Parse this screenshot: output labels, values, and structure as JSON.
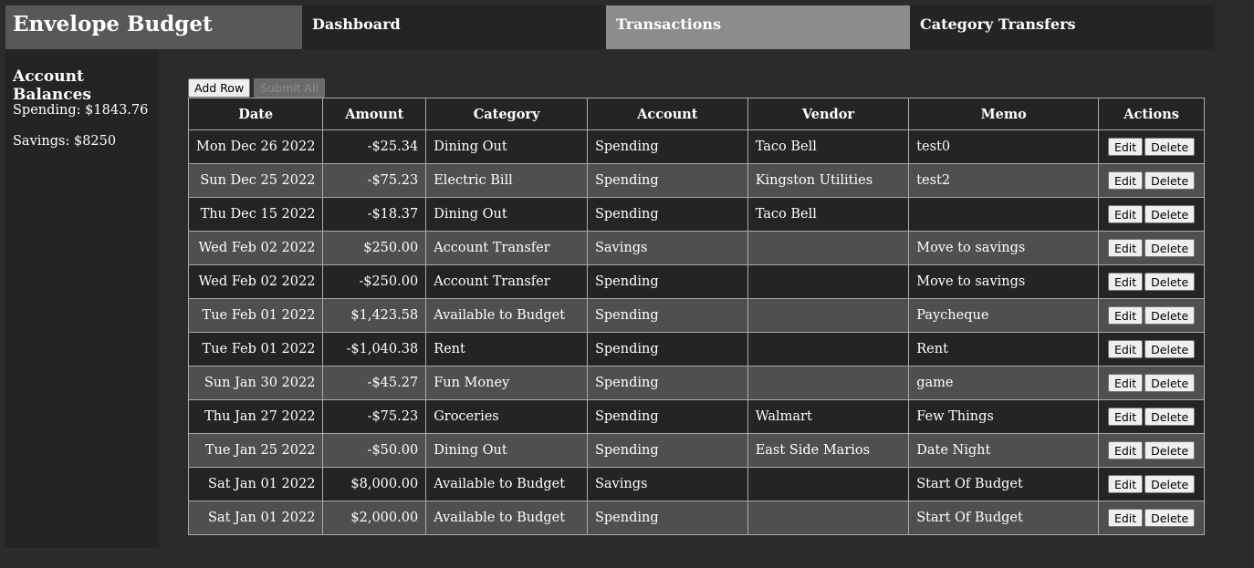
{
  "app": {
    "title": "Envelope Budget"
  },
  "nav": {
    "tabs": [
      {
        "label": "Dashboard",
        "active": false
      },
      {
        "label": "Transactions",
        "active": true
      },
      {
        "label": "Category Transfers",
        "active": false
      }
    ]
  },
  "sidebar": {
    "heading": "Account Balances",
    "balances": [
      "Spending: $1843.76",
      "Savings: $8250"
    ]
  },
  "toolbar": {
    "add_row": "Add Row",
    "submit_all": "Submit All"
  },
  "table": {
    "headers": [
      "Date",
      "Amount",
      "Category",
      "Account",
      "Vendor",
      "Memo",
      "Actions"
    ],
    "edit_label": "Edit",
    "delete_label": "Delete",
    "rows": [
      {
        "date": "Mon Dec 26 2022",
        "amount": "-$25.34",
        "category": "Dining Out",
        "account": "Spending",
        "vendor": "Taco Bell",
        "memo": "test0"
      },
      {
        "date": "Sun Dec 25 2022",
        "amount": "-$75.23",
        "category": "Electric Bill",
        "account": "Spending",
        "vendor": "Kingston Utilities",
        "memo": "test2"
      },
      {
        "date": "Thu Dec 15 2022",
        "amount": "-$18.37",
        "category": "Dining Out",
        "account": "Spending",
        "vendor": "Taco Bell",
        "memo": ""
      },
      {
        "date": "Wed Feb 02 2022",
        "amount": "$250.00",
        "category": "Account Transfer",
        "account": "Savings",
        "vendor": "",
        "memo": "Move to savings"
      },
      {
        "date": "Wed Feb 02 2022",
        "amount": "-$250.00",
        "category": "Account Transfer",
        "account": "Spending",
        "vendor": "",
        "memo": "Move to savings"
      },
      {
        "date": "Tue Feb 01 2022",
        "amount": "$1,423.58",
        "category": "Available to Budget",
        "account": "Spending",
        "vendor": "",
        "memo": "Paycheque"
      },
      {
        "date": "Tue Feb 01 2022",
        "amount": "-$1,040.38",
        "category": "Rent",
        "account": "Spending",
        "vendor": "",
        "memo": "Rent"
      },
      {
        "date": "Sun Jan 30 2022",
        "amount": "-$45.27",
        "category": "Fun Money",
        "account": "Spending",
        "vendor": "",
        "memo": "game"
      },
      {
        "date": "Thu Jan 27 2022",
        "amount": "-$75.23",
        "category": "Groceries",
        "account": "Spending",
        "vendor": "Walmart",
        "memo": "Few Things"
      },
      {
        "date": "Tue Jan 25 2022",
        "amount": "-$50.00",
        "category": "Dining Out",
        "account": "Spending",
        "vendor": "East Side Marios",
        "memo": "Date Night"
      },
      {
        "date": "Sat Jan 01 2022",
        "amount": "$8,000.00",
        "category": "Available to Budget",
        "account": "Savings",
        "vendor": "",
        "memo": "Start Of Budget"
      },
      {
        "date": "Sat Jan 01 2022",
        "amount": "$2,000.00",
        "category": "Available to Budget",
        "account": "Spending",
        "vendor": "",
        "memo": "Start Of Budget"
      }
    ]
  }
}
